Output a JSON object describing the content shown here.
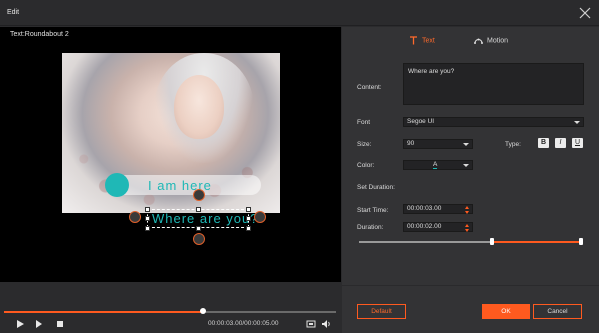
{
  "window": {
    "title": "Edit"
  },
  "preview": {
    "label": "Text:Roundabout 2",
    "overlay_line1": "I am here",
    "overlay_line2": "Where are you?"
  },
  "playback": {
    "progress": 0.6,
    "time": "00:00:03.00/00:00:05.00"
  },
  "tabs": [
    {
      "label": "Text",
      "active": true,
      "icon": "text-t-icon"
    },
    {
      "label": "Motion",
      "active": false,
      "icon": "motion-icon"
    }
  ],
  "form": {
    "content_label": "Content:",
    "content_value": "Where are you?",
    "font_label": "Font",
    "font_value": "Segoe UI",
    "size_label": "Size:",
    "size_value": "90",
    "type_label": "Type:",
    "type_bold": "B",
    "type_italic": "I",
    "type_underline": "U",
    "color_label": "Color:",
    "color_value": "A",
    "color_accent": "#1fb8b6",
    "set_duration_label": "Set Duration:",
    "start_time_label": "Start Time:",
    "start_time_value": "00:00:03.00",
    "duration_label": "Duration:",
    "duration_value": "00:00:02.00"
  },
  "buttons": {
    "default": "Default",
    "ok": "OK",
    "cancel": "Cancel"
  },
  "colors": {
    "accent": "#ff5a1f",
    "panel": "#333335",
    "preview_bg": "#000000"
  }
}
